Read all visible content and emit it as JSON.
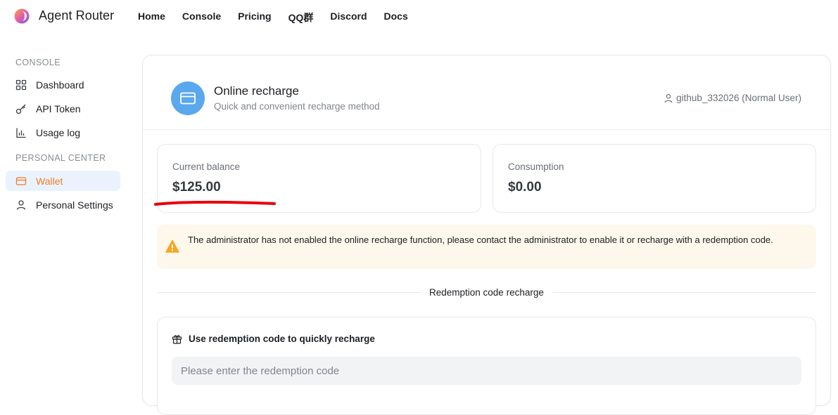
{
  "app": {
    "title": "Agent Router",
    "logo_icon": "agent-router-logo-icon"
  },
  "nav": {
    "items": [
      {
        "label": "Home"
      },
      {
        "label": "Console"
      },
      {
        "label": "Pricing"
      },
      {
        "label": "QQ群"
      },
      {
        "label": "Discord"
      },
      {
        "label": "Docs"
      }
    ]
  },
  "sidebar": {
    "console_section": "CONSOLE",
    "personal_section": "PERSONAL CENTER",
    "items": [
      {
        "label": "Dashboard",
        "icon": "dashboard-icon"
      },
      {
        "label": "API Token",
        "icon": "key-icon"
      },
      {
        "label": "Usage log",
        "icon": "chart-icon"
      },
      {
        "label": "Wallet",
        "icon": "wallet-icon",
        "active": true
      },
      {
        "label": "Personal Settings",
        "icon": "user-icon"
      }
    ]
  },
  "header": {
    "title": "Online recharge",
    "subtitle": "Quick and convenient recharge method",
    "user": "github_332026 (Normal User)",
    "icon": "credit-card-icon"
  },
  "stats": {
    "balance_label": "Current balance",
    "balance_value": "$125.00",
    "consumption_label": "Consumption",
    "consumption_value": "$0.00"
  },
  "notice": {
    "text": "The administrator has not enabled the online recharge function, please contact the administrator to enable it or recharge with a redemption code.",
    "icon": "warning-icon"
  },
  "redeem": {
    "divider_label": "Redemption code recharge",
    "title": "Use redemption code to quickly recharge",
    "placeholder": "Please enter the redemption code",
    "icon": "gift-icon"
  },
  "colors": {
    "accent": "#f27c2b",
    "active_bg": "#eaf3fd",
    "header_icon_bg": "#5aa8ee",
    "warning_bg": "#fef7ec",
    "warning_icon": "#f5a623",
    "annotation": "#e8000b"
  }
}
